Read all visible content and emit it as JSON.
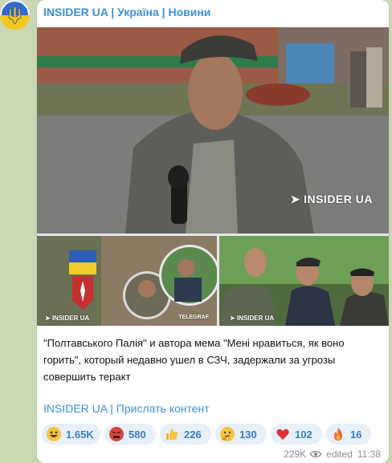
{
  "channel": {
    "name": "INSIDER UA | Україна | Новини"
  },
  "media": {
    "main_watermark": "INSIDER UA",
    "left_watermark": "INSIDER UA",
    "left_tg_watermark": "TELEGRAF",
    "right_watermark": "INSIDER UA"
  },
  "post": {
    "caption": "\"Полтавського Палія\" и автора мема \"Мені нравиться, як воно горить\", который недавно ушел в СЗЧ, задержали за угрозы совершить теракт",
    "link1": "INSIDER UA",
    "separator": "|",
    "link2": "Прислать контент"
  },
  "reactions": [
    {
      "icon": "grinning-face-icon",
      "count": "1.65K"
    },
    {
      "icon": "angry-face-icon",
      "count": "580"
    },
    {
      "icon": "thumbs-up-icon",
      "count": "226"
    },
    {
      "icon": "thinking-face-icon",
      "count": "130"
    },
    {
      "icon": "heart-icon",
      "count": "102"
    },
    {
      "icon": "fire-icon",
      "count": "16"
    }
  ],
  "meta": {
    "views": "229K",
    "edited_label": "edited",
    "time": "11:38"
  },
  "colors": {
    "accent": "#3a8fd6",
    "reaction_bg": "#e7f0f8",
    "chat_bg": "#c9d8b3"
  }
}
